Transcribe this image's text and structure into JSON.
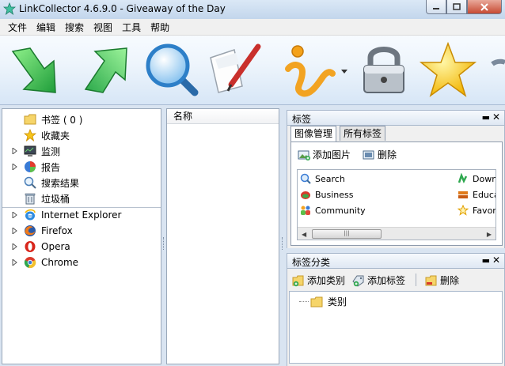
{
  "window": {
    "title": "LinkCollector 4.6.9.0 - Giveaway of the Day",
    "minimize": "─",
    "maximize": "□",
    "close": "✕"
  },
  "menu": [
    "文件",
    "编辑",
    "搜索",
    "视图",
    "工具",
    "帮助"
  ],
  "toolbar": {
    "buttons": [
      "go-down-arrow-icon",
      "go-up-arrow-icon",
      "search-magnifier-icon",
      "edit-pencil-icon",
      "info-icon",
      "lock-icon",
      "star-icon"
    ]
  },
  "left_tree": {
    "items": [
      {
        "label": "书签 ( 0 )",
        "icon": "folder-icon",
        "expandable": false
      },
      {
        "label": "收藏夹",
        "icon": "star-icon",
        "expandable": false
      },
      {
        "label": "监测",
        "icon": "monitor-icon",
        "expandable": true
      },
      {
        "label": "报告",
        "icon": "pie-chart-icon",
        "expandable": true
      },
      {
        "label": "搜索结果",
        "icon": "search-icon",
        "expandable": false
      },
      {
        "label": "垃圾桶",
        "icon": "trash-icon",
        "expandable": false
      }
    ],
    "browsers": [
      {
        "label": "Internet Explorer",
        "icon": "ie-icon"
      },
      {
        "label": "Firefox",
        "icon": "firefox-icon"
      },
      {
        "label": "Opera",
        "icon": "opera-icon"
      },
      {
        "label": "Chrome",
        "icon": "chrome-icon"
      }
    ]
  },
  "middle": {
    "column_header": "名称"
  },
  "tags_panel": {
    "title": "标签",
    "pin": "▬",
    "close": "✕",
    "tabs": [
      "图像管理",
      "所有标签"
    ],
    "active_tab": 0,
    "add_image": "添加图片",
    "delete": "删除",
    "tags_left": [
      "Search",
      "Business",
      "Community"
    ],
    "tags_right": [
      "Down",
      "Educa",
      "Favor"
    ],
    "scroll_thumb": "|||"
  },
  "category_panel": {
    "title": "标签分类",
    "pin": "▬",
    "close": "✕",
    "add_category": "添加类别",
    "add_tag": "添加标签",
    "delete": "删除",
    "root_node": "类别"
  },
  "colors": {
    "accent": "#3a7bd5",
    "panel_border": "#9aa8ba",
    "toolbar_bg": "#eef5fc"
  }
}
